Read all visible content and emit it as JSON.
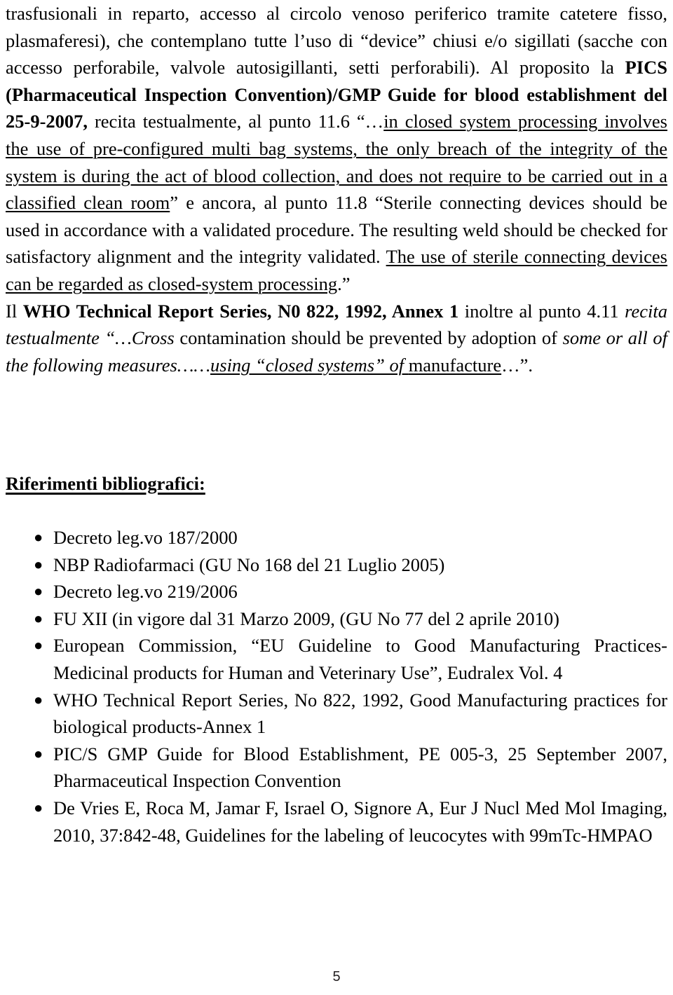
{
  "document": {
    "page_number": "5",
    "paragraphs": {
      "p1": {
        "run1": "trasfusionali in reparto, accesso al circolo venoso periferico tramite catetere fisso, plasmaferesi), che contemplano tutte l’uso di “device” chiusi e/o sigillati (sacche con accesso perforabile, valvole autosigillanti, setti perforabili). Al proposito la ",
        "run2_bold": "PICS (Pharmaceutical Inspection Convention)/GMP Guide for blood establishment del 25-9-2007,",
        "run3": " recita testualmente, al punto 11.6 “…",
        "run4_underline": "in closed system processing involves the use of pre-configured multi bag systems, the only breach of the integrity of the system is during the act of blood collection, and does not require to be carried out in a classified clean room",
        "run5": "” e ancora, al punto 11.8 “Sterile connecting devices should be used in accordance with a validated procedure. The resulting weld should be checked for satisfactory alignment and the integrity validated. ",
        "run6_underline": "The use of sterile connecting devices can be regarded as closed-system processing",
        "run7": ".”"
      },
      "p2": {
        "run1": "Il ",
        "run2_bold": "WHO Technical Report Series, N0 822, 1992, Annex 1",
        "run3": " inoltre al punto 4.11 ",
        "run4_italic": "recita testualmente",
        "run5_italic": " “…Cross",
        "run6": " contamination should be prevented by adoption of ",
        "run7_italic": "some or all of the following measures……",
        "run8_italic_underline": "using “closed systems” of ",
        "run9_underline": "manufacture",
        "run10": "…”."
      }
    },
    "references_heading": "Riferimenti bibliografici:",
    "bullet_glyph": "●",
    "references": [
      "Decreto leg.vo 187/2000",
      "NBP Radiofarmaci (GU No 168 del 21 Luglio 2005)",
      "Decreto leg.vo 219/2006",
      "FU XII (in vigore dal 31 Marzo 2009, (GU No 77 del 2 aprile 2010)",
      "European Commission, “EU Guideline to Good Manufacturing Practices-Medicinal products for Human and Veterinary Use”, Eudralex Vol. 4",
      "WHO Technical Report Series, No 822, 1992, Good Manufacturing practices for biological products-Annex 1",
      "PIC/S GMP Guide for Blood Establishment, PE 005-3, 25 September 2007, Pharmaceutical Inspection Convention",
      "De Vries E, Roca M, Jamar F, Israel O, Signore A, Eur J Nucl Med Mol Imaging, 2010, 37:842-48, Guidelines for the labeling of leucocytes with 99mTc-HMPAO"
    ]
  }
}
